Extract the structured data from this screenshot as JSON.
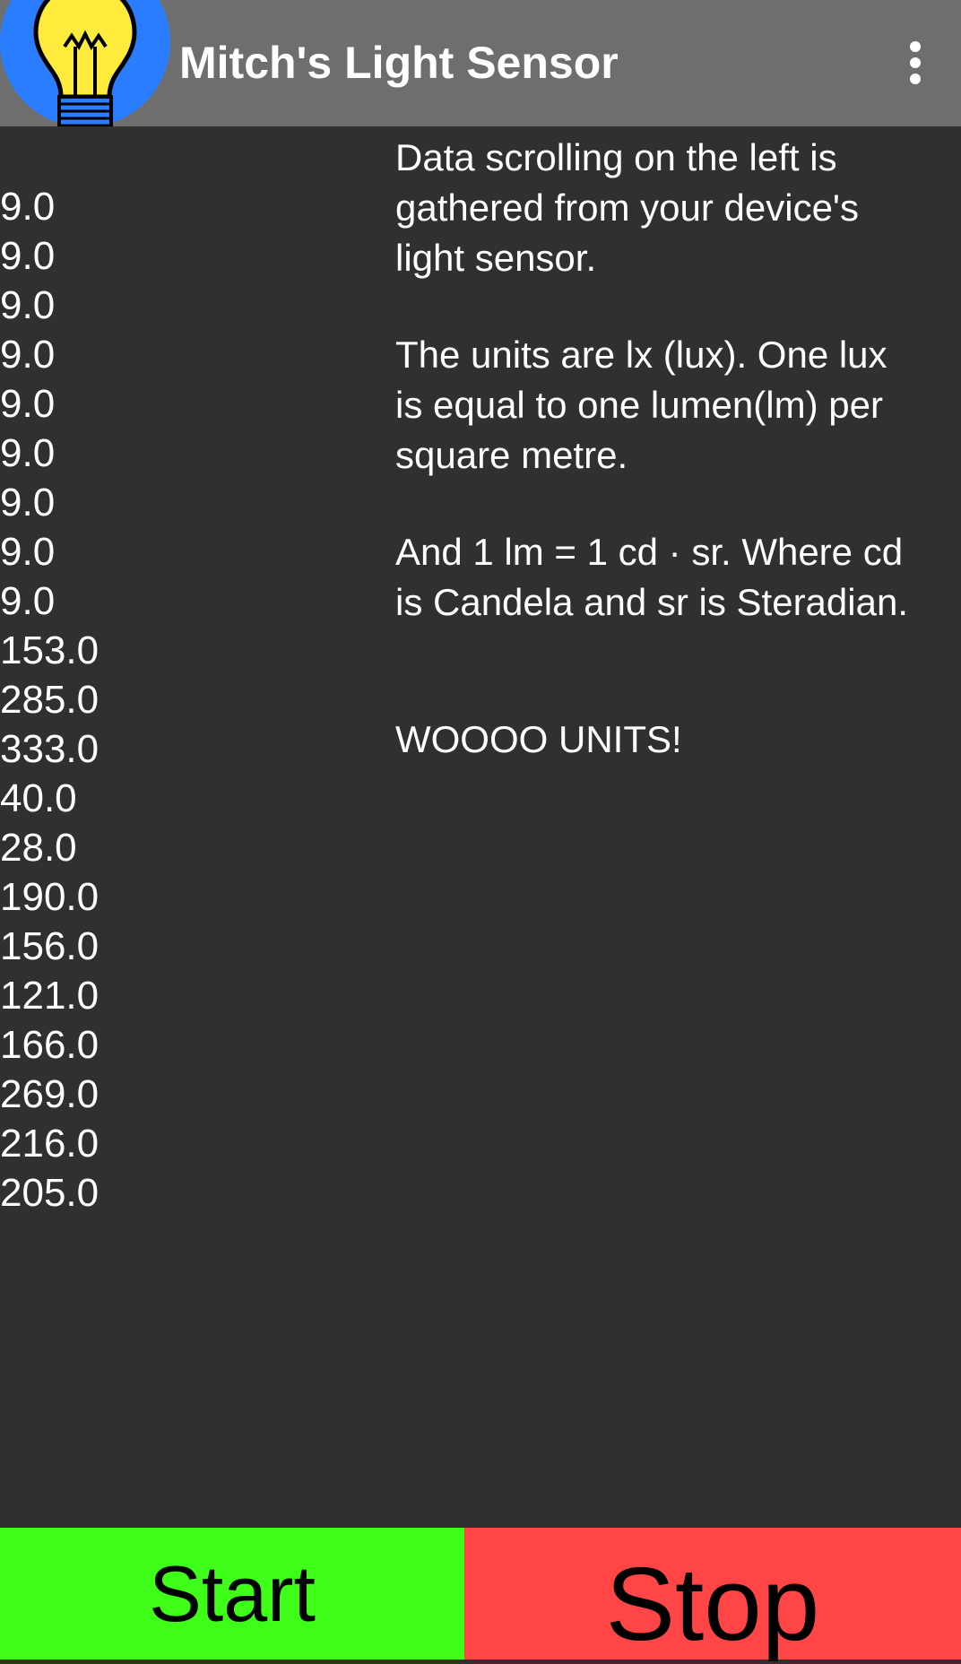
{
  "app_bar": {
    "title": "Mitch's Light Sensor",
    "icon": "lightbulb-icon",
    "menu_icon": "more-vertical-icon",
    "background": "#6e6e6e"
  },
  "readings": [
    "9.0",
    "9.0",
    "9.0",
    "9.0",
    "9.0",
    "9.0",
    "9.0",
    "9.0",
    "9.0",
    "153.0",
    "285.0",
    "333.0",
    "40.0",
    "28.0",
    "190.0",
    "156.0",
    "121.0",
    "166.0",
    "269.0",
    "216.0",
    "205.0"
  ],
  "info": {
    "p1": [
      "Data scrolling on the left is",
      "gathered from your device's",
      "light sensor."
    ],
    "p2": [
      "The units are lx (lux). One lux",
      "is equal to one lumen(lm) per",
      "square metre."
    ],
    "p3": [
      "And 1 lm = 1 cd · sr. Where cd",
      "is Candela and sr is Steradian."
    ],
    "p4": "WOOOO UNITS!"
  },
  "buttons": {
    "start_label": "Start",
    "stop_label": "Stop",
    "start_color": "#3dfd19",
    "stop_color": "#ff4545"
  },
  "colors": {
    "background": "#303030",
    "text": "#ffffff"
  }
}
